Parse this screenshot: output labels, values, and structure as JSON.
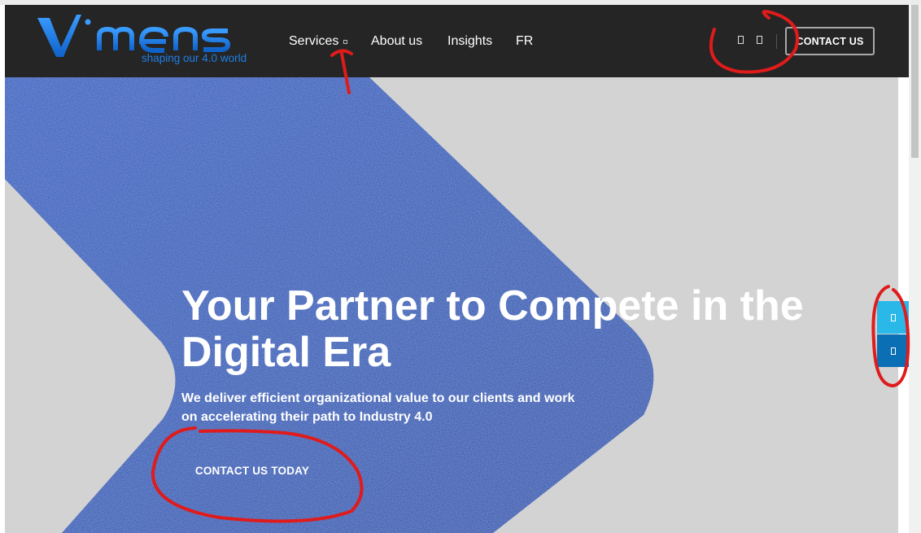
{
  "brand": {
    "logo_text": "Vimens",
    "tagline": "shaping our 4.0 world",
    "logo_color": "#1e7fe6"
  },
  "nav": {
    "items": [
      {
        "label": "Services",
        "has_dropdown": true
      },
      {
        "label": "About us"
      },
      {
        "label": "Insights"
      },
      {
        "label": "FR"
      }
    ]
  },
  "header": {
    "icons": [
      "search-icon",
      "cart-icon"
    ],
    "contact_label": "CONTACT US",
    "background": "#252525"
  },
  "hero": {
    "title": "Your Partner to Compete in the Digital Era",
    "subtitle": "We deliver efficient organizational value to our clients and work on accelerating their path to Industry 4.0",
    "cta_label": "CONTACT US TODAY",
    "shape_color": "#1a4aa8",
    "background": "#d3d3d3"
  },
  "floating_tabs": [
    {
      "icon": "phone-icon",
      "color": "#29b8e8"
    },
    {
      "icon": "mail-icon",
      "color": "#0a6fb5"
    }
  ],
  "annotations": {
    "color": "#e01b1b"
  }
}
